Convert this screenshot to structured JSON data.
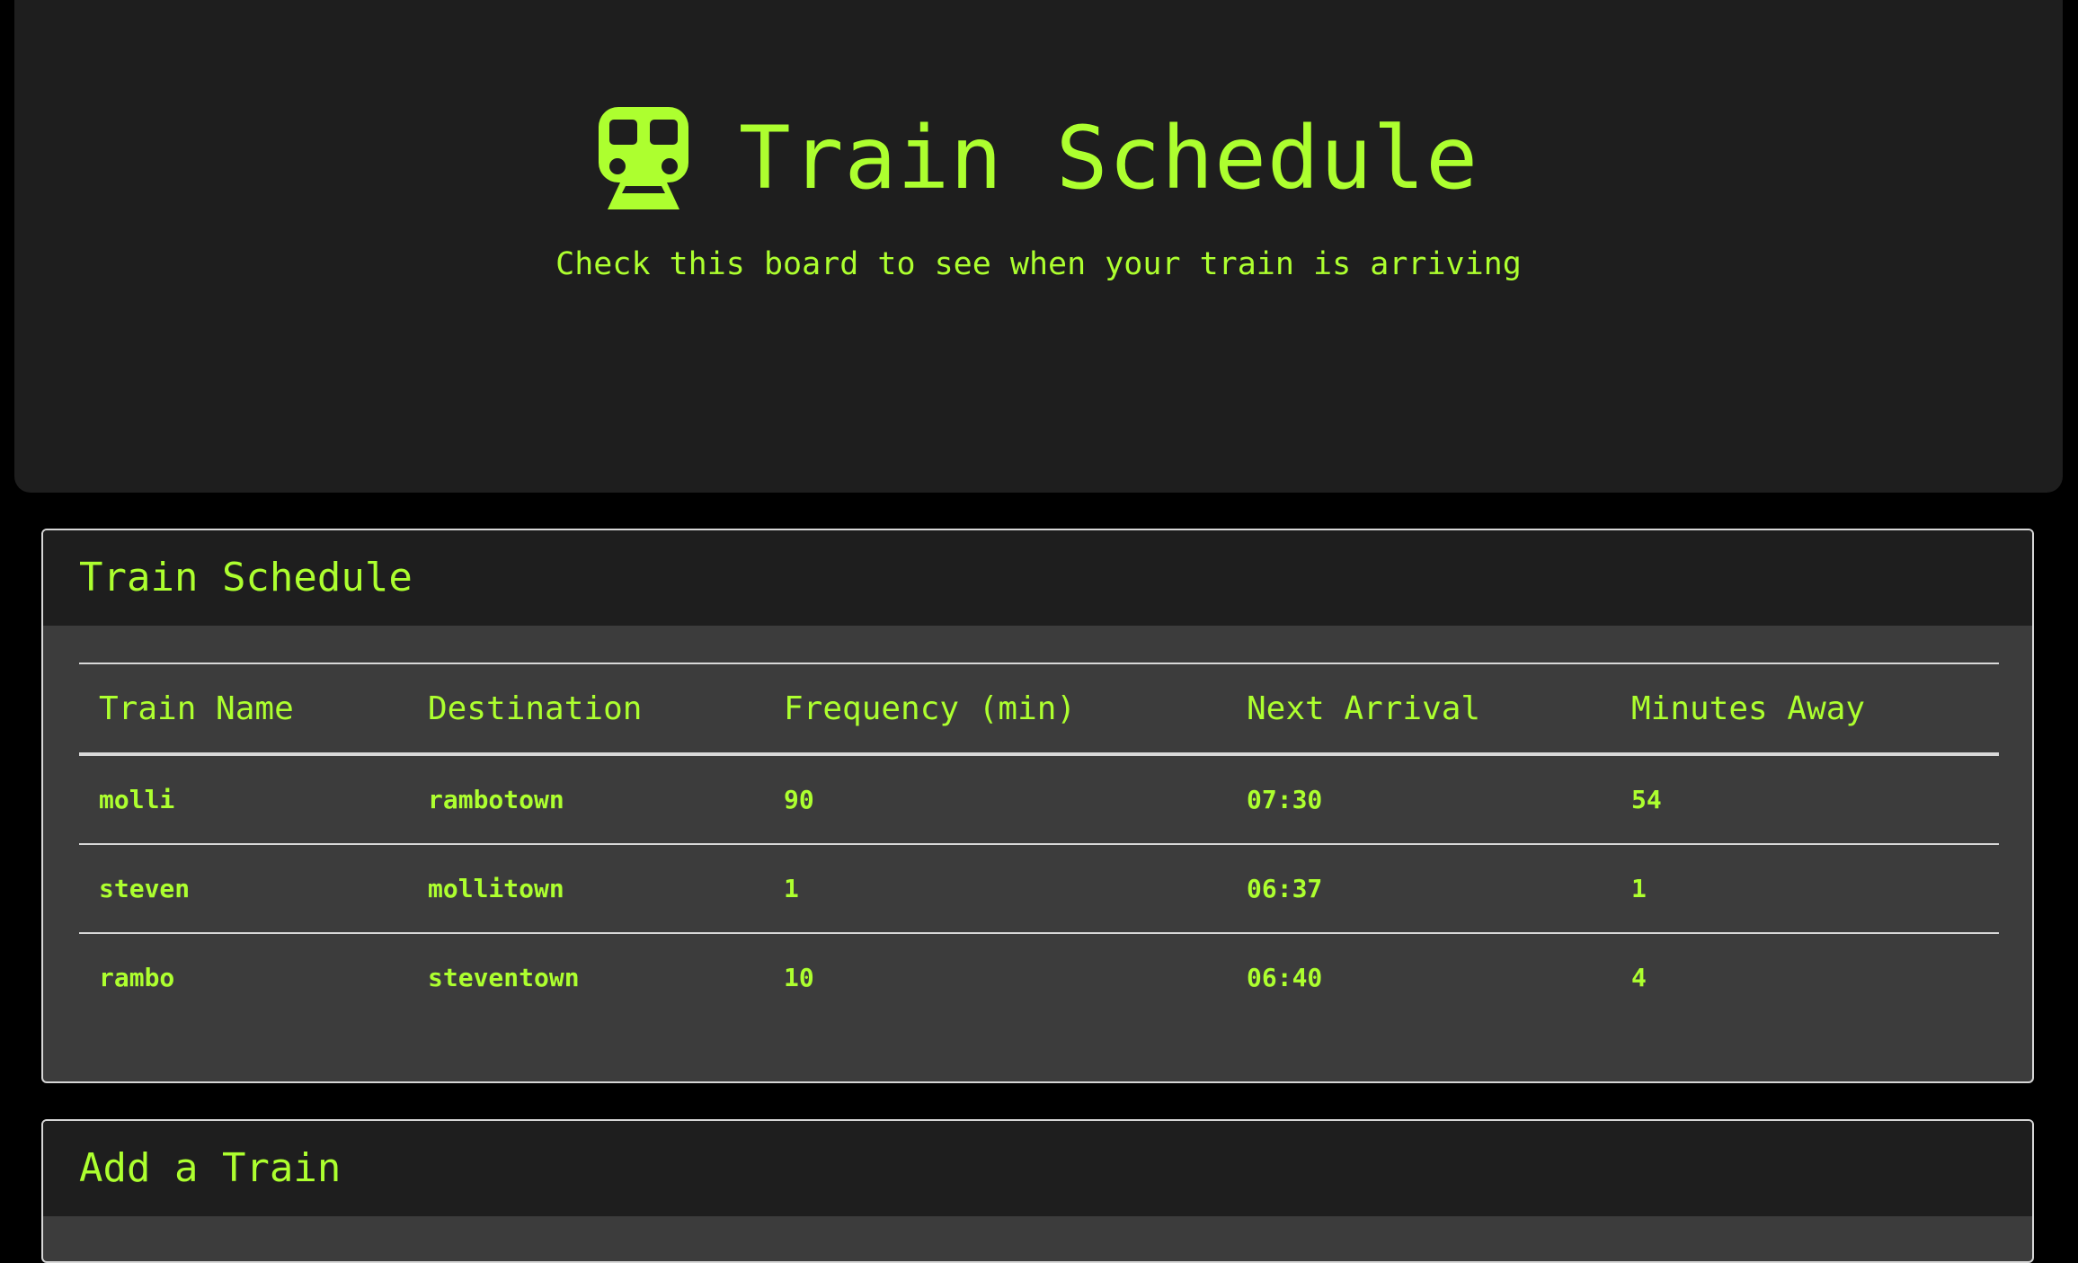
{
  "header": {
    "icon": "train-icon",
    "title": "Train Schedule",
    "subtitle": "Check this board to see when your train is arriving"
  },
  "schedule_panel": {
    "heading": "Train Schedule",
    "columns": [
      "Train Name",
      "Destination",
      "Frequency (min)",
      "Next Arrival",
      "Minutes Away"
    ],
    "rows": [
      [
        "molli",
        "rambotown",
        "90",
        "07:30",
        "54"
      ],
      [
        "steven",
        "mollitown",
        "1",
        "06:37",
        "1"
      ],
      [
        "rambo",
        "steventown",
        "10",
        "06:40",
        "4"
      ]
    ]
  },
  "add_panel": {
    "heading": "Add a Train"
  },
  "colors": {
    "accent": "#adff2f",
    "background": "#000000",
    "jumbotron": "#1e1e1e",
    "panel_body": "#3c3c3c"
  }
}
